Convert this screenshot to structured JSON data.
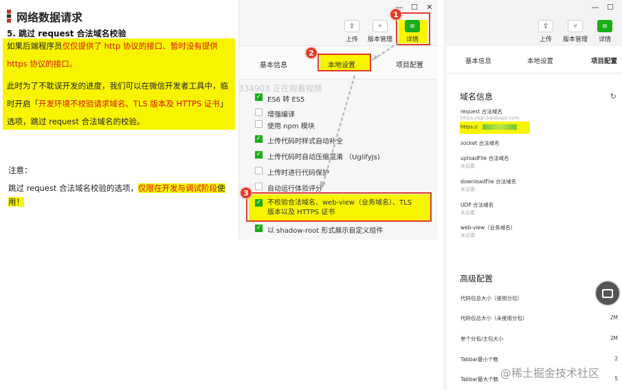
{
  "doc": {
    "title": "网络数据请求",
    "subtitle": "5. 跳过 request 合法域名校验",
    "p1_a": "如果后端程序员",
    "p1_b": "仅仅提供了 http 协议的接口、暂时没有提供 https 协议的接口。",
    "p2_a": "此时为了不耽误开发的进度，我们可以在微信开发者工具中，临时开启「",
    "p2_b": "开发环境不校验请求域名、TLS 版本及 HTTPS 证书",
    "p2_c": "」选项，跳过 request 合法域名的校验。",
    "note": "注意：",
    "last_a": "跳过 request 合法域名校验的选项，",
    "last_b": "仅限在开发与调试阶段",
    "last_c": "使用！"
  },
  "devtools": {
    "toolbar": {
      "upload": "上传",
      "version": "版本管理",
      "details": "详情"
    },
    "tabs": [
      "基本信息",
      "本地设置",
      "项目配置"
    ],
    "checkboxes": [
      {
        "label": "ES6 转 ES5",
        "checked": true
      },
      {
        "label": "增强编译",
        "checked": false
      },
      {
        "label": "使用 npm 模块",
        "checked": false
      },
      {
        "label": "上传代码时样式自动补全",
        "checked": true
      },
      {
        "label": "上传代码时自动压缩混淆 （UglifyJs)",
        "checked": true
      },
      {
        "label": "上传时进行代码保护",
        "checked": false
      },
      {
        "label": "自动运行体验评分",
        "checked": false
      },
      {
        "label": "不校验合法域名、web-view（业务域名）、TLS 版本以及 HTTPS 证书",
        "checked": true
      },
      {
        "label": "以 shadow-root 形式展示自定义组件",
        "checked": true
      }
    ],
    "overlay": "334903 正在观看视频",
    "markers": [
      "1",
      "2",
      "3"
    ]
  },
  "project": {
    "toolbar": {
      "upload": "上传",
      "version": "版本管理",
      "details": "详情"
    },
    "tabs": [
      "基本信息",
      "本地设置",
      "项目配置"
    ],
    "domain_title": "域名信息",
    "domains": [
      {
        "key": "request 合法域名",
        "value": "https://api.baiduapi.com"
      },
      {
        "key": "",
        "value": "https://"
      },
      {
        "key": "socket 合法域名",
        "value": ""
      },
      {
        "key": "uploadFile 合法域名",
        "value": "未设置"
      },
      {
        "key": "downloadFile 合法域名",
        "value": "未设置"
      },
      {
        "key": "UDP 合法域名",
        "value": "未设置"
      },
      {
        "key": "web-view（业务域名）",
        "value": "未设置"
      }
    ],
    "advanced_title": "高级配置",
    "advanced": [
      {
        "key": "代码包总大小（使用分包）",
        "value": ""
      },
      {
        "key": "代码包总大小（未使用分包）",
        "value": "2M"
      },
      {
        "key": "单个分包/主包大小",
        "value": "2M"
      },
      {
        "key": "Tabbar最小个数",
        "value": "2"
      },
      {
        "key": "Tabbar最大个数",
        "value": "5"
      }
    ]
  },
  "watermark": "@稀土掘金技术社区",
  "colors": {
    "accent_green": "#1aad19",
    "highlight": "#f8f400",
    "annotation_red": "#e03a2a"
  }
}
